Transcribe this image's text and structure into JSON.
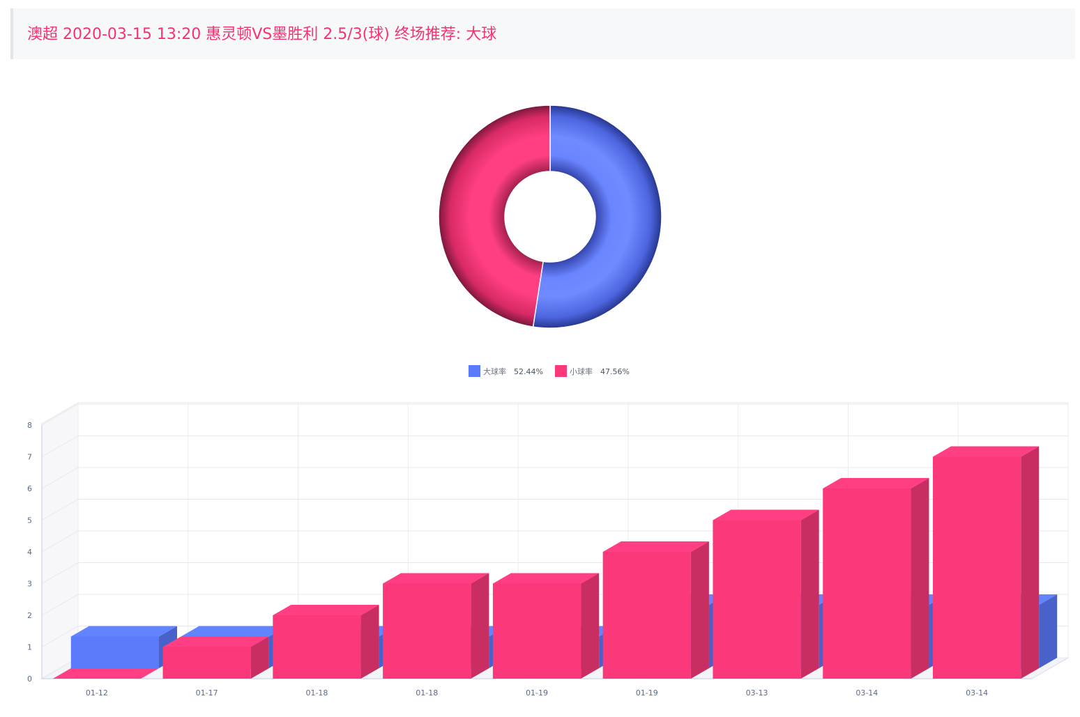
{
  "header": {
    "title": "澳超 2020-03-15 13:20 惠灵顿VS墨胜利 2.5/3(球) 终场推荐: 大球"
  },
  "colors": {
    "blue": "#5b7bfb",
    "pink": "#fb397a",
    "title": "#f5336f"
  },
  "chart_data": [
    {
      "type": "pie",
      "subtype": "donut",
      "slices": [
        {
          "name": "大球率",
          "value": 52.44,
          "label": "52.44%",
          "color": "#5b7bfb"
        },
        {
          "name": "小球率",
          "value": 47.56,
          "label": "47.56%",
          "color": "#fb397a"
        }
      ],
      "legend_position": "bottom-center"
    },
    {
      "type": "bar",
      "subtype": "3d-bar",
      "categories": [
        "01-12",
        "01-17",
        "01-18",
        "01-18",
        "01-19",
        "01-19",
        "03-13",
        "03-14",
        "03-14"
      ],
      "series": [
        {
          "color": "#5b7bfb",
          "values": [
            1,
            1,
            1,
            1,
            1,
            2,
            2,
            2,
            2
          ]
        },
        {
          "color": "#fb397a",
          "values": [
            0,
            1,
            2,
            3,
            3,
            4,
            5,
            6,
            7
          ]
        }
      ],
      "yticks": [
        "0",
        "1",
        "2",
        "3",
        "4",
        "5",
        "6",
        "7",
        "8"
      ],
      "ylim": [
        0,
        8
      ],
      "grid": true,
      "legend": false
    }
  ]
}
